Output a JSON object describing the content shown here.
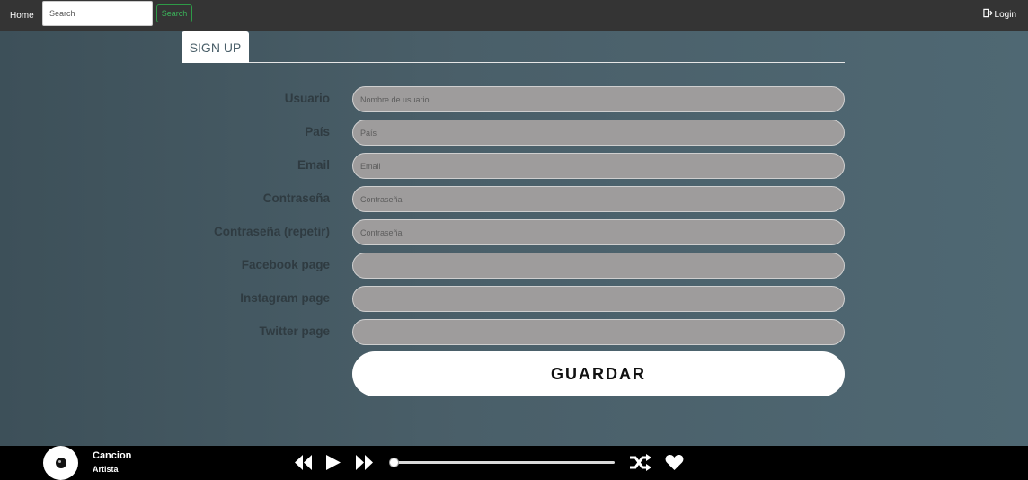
{
  "navbar": {
    "home_label": "Home",
    "search_placeholder": "Search",
    "search_button": "Search",
    "login_label": "Login"
  },
  "tab": {
    "label": "SIGN UP"
  },
  "form": {
    "fields": [
      {
        "label": "Usuario",
        "placeholder": "Nombre de usuario",
        "value": ""
      },
      {
        "label": "País",
        "placeholder": "País",
        "value": ""
      },
      {
        "label": "Email",
        "placeholder": "Email",
        "value": ""
      },
      {
        "label": "Contraseña",
        "placeholder": "Contraseña",
        "value": ""
      },
      {
        "label": "Contraseña (repetir)",
        "placeholder": "Contraseña",
        "value": ""
      },
      {
        "label": "Facebook page",
        "placeholder": "",
        "value": ""
      },
      {
        "label": "Instagram page",
        "placeholder": "",
        "value": ""
      },
      {
        "label": "Twitter page",
        "placeholder": "",
        "value": ""
      }
    ],
    "save_button": "GUARDAR"
  },
  "player": {
    "song": "Cancion",
    "artist": "Artista",
    "progress": 0,
    "icons": [
      "disc-icon",
      "rewind-icon",
      "play-icon",
      "fast-forward-icon",
      "shuffle-icon",
      "heart-icon"
    ]
  },
  "colors": {
    "navbar": "#343434",
    "search_button_accent": "#3bb35a",
    "input_fill": "#9e9c9c",
    "player_bar": "#000000"
  }
}
